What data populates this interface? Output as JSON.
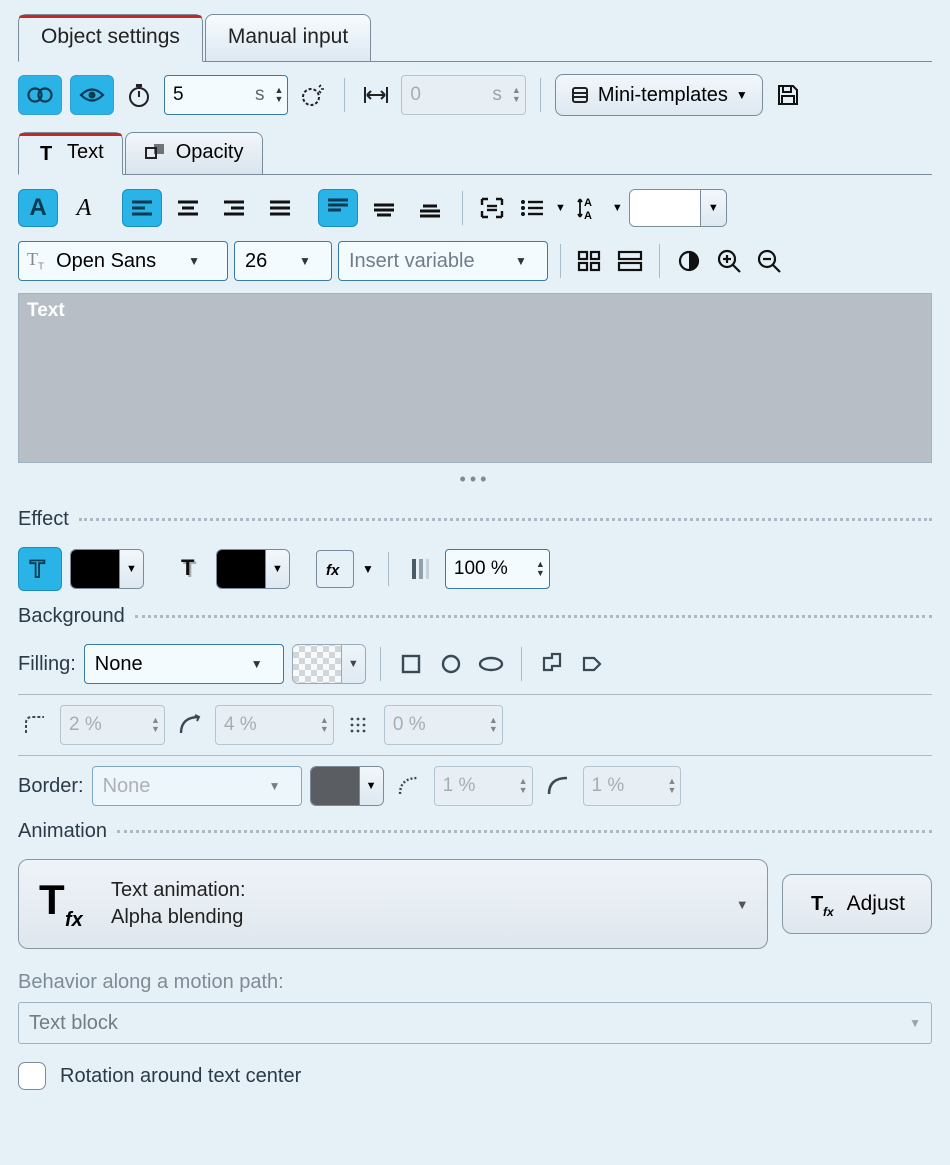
{
  "tabs_top": {
    "object_settings": "Object settings",
    "manual_input": "Manual input"
  },
  "timing": {
    "duration_value": "5",
    "duration_unit": "s",
    "offset_value": "0",
    "offset_unit": "s"
  },
  "mini_templates_label": "Mini-templates",
  "tabs_inner": {
    "text": "Text",
    "opacity": "Opacity"
  },
  "font": {
    "family": "Open Sans",
    "size": "26",
    "insert_variable": "Insert variable"
  },
  "textarea_placeholder": "Text",
  "effect": {
    "section": "Effect",
    "preset_color": "#000000",
    "shadow_color": "#000000",
    "opacity_value": "100 %"
  },
  "background": {
    "section": "Background",
    "filling_label": "Filling:",
    "filling_value": "None",
    "corner_radius": "2 %",
    "arc": "4 %",
    "blur": "0 %",
    "border_label": "Border:",
    "border_value": "None",
    "border_color": "#5a5e63",
    "border_dash": "1 %",
    "border_curve": "1 %"
  },
  "animation": {
    "section": "Animation",
    "line1": "Text animation:",
    "line2": "Alpha blending",
    "adjust": "Adjust"
  },
  "motion": {
    "label": "Behavior along a motion path:",
    "value": "Text block",
    "rotation_label": "Rotation around text center"
  },
  "colors": {
    "accent": "#29b3e6",
    "text_color_swatch": "#ffffff"
  }
}
